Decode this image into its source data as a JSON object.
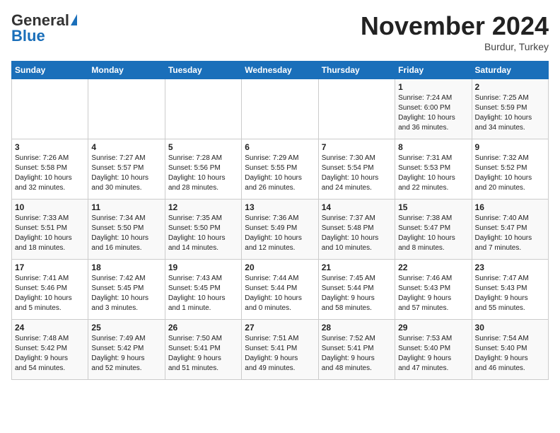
{
  "header": {
    "logo_general": "General",
    "logo_blue": "Blue",
    "month": "November 2024",
    "location": "Burdur, Turkey"
  },
  "columns": [
    "Sunday",
    "Monday",
    "Tuesday",
    "Wednesday",
    "Thursday",
    "Friday",
    "Saturday"
  ],
  "weeks": [
    {
      "days": [
        {
          "num": "",
          "info": ""
        },
        {
          "num": "",
          "info": ""
        },
        {
          "num": "",
          "info": ""
        },
        {
          "num": "",
          "info": ""
        },
        {
          "num": "",
          "info": ""
        },
        {
          "num": "1",
          "info": "Sunrise: 7:24 AM\nSunset: 6:00 PM\nDaylight: 10 hours\nand 36 minutes."
        },
        {
          "num": "2",
          "info": "Sunrise: 7:25 AM\nSunset: 5:59 PM\nDaylight: 10 hours\nand 34 minutes."
        }
      ]
    },
    {
      "days": [
        {
          "num": "3",
          "info": "Sunrise: 7:26 AM\nSunset: 5:58 PM\nDaylight: 10 hours\nand 32 minutes."
        },
        {
          "num": "4",
          "info": "Sunrise: 7:27 AM\nSunset: 5:57 PM\nDaylight: 10 hours\nand 30 minutes."
        },
        {
          "num": "5",
          "info": "Sunrise: 7:28 AM\nSunset: 5:56 PM\nDaylight: 10 hours\nand 28 minutes."
        },
        {
          "num": "6",
          "info": "Sunrise: 7:29 AM\nSunset: 5:55 PM\nDaylight: 10 hours\nand 26 minutes."
        },
        {
          "num": "7",
          "info": "Sunrise: 7:30 AM\nSunset: 5:54 PM\nDaylight: 10 hours\nand 24 minutes."
        },
        {
          "num": "8",
          "info": "Sunrise: 7:31 AM\nSunset: 5:53 PM\nDaylight: 10 hours\nand 22 minutes."
        },
        {
          "num": "9",
          "info": "Sunrise: 7:32 AM\nSunset: 5:52 PM\nDaylight: 10 hours\nand 20 minutes."
        }
      ]
    },
    {
      "days": [
        {
          "num": "10",
          "info": "Sunrise: 7:33 AM\nSunset: 5:51 PM\nDaylight: 10 hours\nand 18 minutes."
        },
        {
          "num": "11",
          "info": "Sunrise: 7:34 AM\nSunset: 5:50 PM\nDaylight: 10 hours\nand 16 minutes."
        },
        {
          "num": "12",
          "info": "Sunrise: 7:35 AM\nSunset: 5:50 PM\nDaylight: 10 hours\nand 14 minutes."
        },
        {
          "num": "13",
          "info": "Sunrise: 7:36 AM\nSunset: 5:49 PM\nDaylight: 10 hours\nand 12 minutes."
        },
        {
          "num": "14",
          "info": "Sunrise: 7:37 AM\nSunset: 5:48 PM\nDaylight: 10 hours\nand 10 minutes."
        },
        {
          "num": "15",
          "info": "Sunrise: 7:38 AM\nSunset: 5:47 PM\nDaylight: 10 hours\nand 8 minutes."
        },
        {
          "num": "16",
          "info": "Sunrise: 7:40 AM\nSunset: 5:47 PM\nDaylight: 10 hours\nand 7 minutes."
        }
      ]
    },
    {
      "days": [
        {
          "num": "17",
          "info": "Sunrise: 7:41 AM\nSunset: 5:46 PM\nDaylight: 10 hours\nand 5 minutes."
        },
        {
          "num": "18",
          "info": "Sunrise: 7:42 AM\nSunset: 5:45 PM\nDaylight: 10 hours\nand 3 minutes."
        },
        {
          "num": "19",
          "info": "Sunrise: 7:43 AM\nSunset: 5:45 PM\nDaylight: 10 hours\nand 1 minute."
        },
        {
          "num": "20",
          "info": "Sunrise: 7:44 AM\nSunset: 5:44 PM\nDaylight: 10 hours\nand 0 minutes."
        },
        {
          "num": "21",
          "info": "Sunrise: 7:45 AM\nSunset: 5:44 PM\nDaylight: 9 hours\nand 58 minutes."
        },
        {
          "num": "22",
          "info": "Sunrise: 7:46 AM\nSunset: 5:43 PM\nDaylight: 9 hours\nand 57 minutes."
        },
        {
          "num": "23",
          "info": "Sunrise: 7:47 AM\nSunset: 5:43 PM\nDaylight: 9 hours\nand 55 minutes."
        }
      ]
    },
    {
      "days": [
        {
          "num": "24",
          "info": "Sunrise: 7:48 AM\nSunset: 5:42 PM\nDaylight: 9 hours\nand 54 minutes."
        },
        {
          "num": "25",
          "info": "Sunrise: 7:49 AM\nSunset: 5:42 PM\nDaylight: 9 hours\nand 52 minutes."
        },
        {
          "num": "26",
          "info": "Sunrise: 7:50 AM\nSunset: 5:41 PM\nDaylight: 9 hours\nand 51 minutes."
        },
        {
          "num": "27",
          "info": "Sunrise: 7:51 AM\nSunset: 5:41 PM\nDaylight: 9 hours\nand 49 minutes."
        },
        {
          "num": "28",
          "info": "Sunrise: 7:52 AM\nSunset: 5:41 PM\nDaylight: 9 hours\nand 48 minutes."
        },
        {
          "num": "29",
          "info": "Sunrise: 7:53 AM\nSunset: 5:40 PM\nDaylight: 9 hours\nand 47 minutes."
        },
        {
          "num": "30",
          "info": "Sunrise: 7:54 AM\nSunset: 5:40 PM\nDaylight: 9 hours\nand 46 minutes."
        }
      ]
    }
  ]
}
